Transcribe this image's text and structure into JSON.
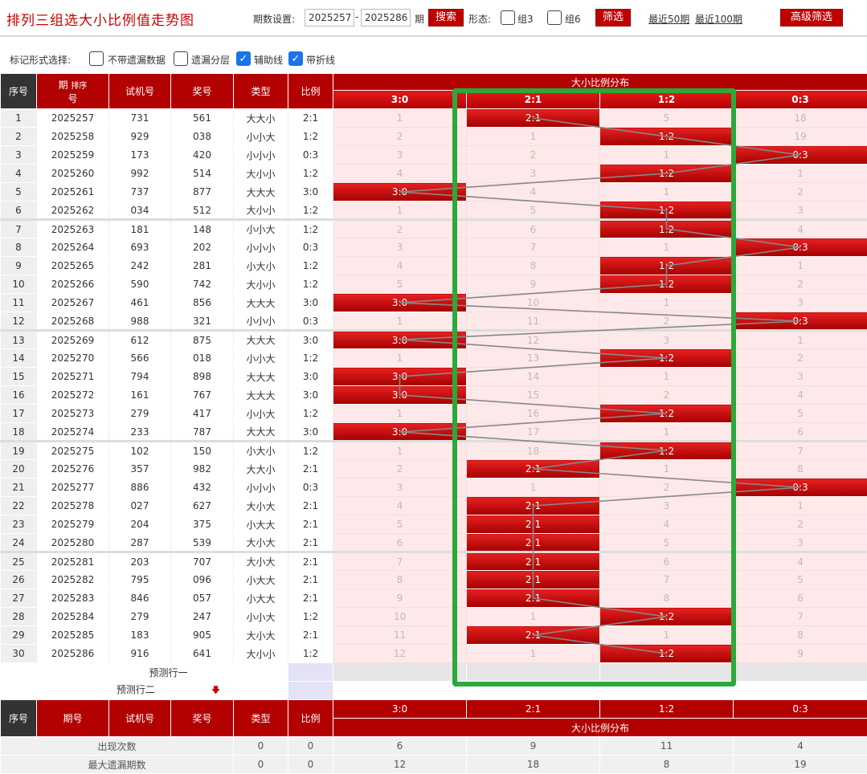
{
  "header": {
    "title": "排列三组选大小比例值走势图",
    "period_label": "期数设置:",
    "from": "2025257",
    "dash": "-",
    "to": "2025286",
    "period_suffix": "期",
    "search": "搜索",
    "shape_label": "形态:",
    "group3": "组3",
    "group6": "组6",
    "filter": "筛选",
    "recent50": "最近50期",
    "recent100": "最近100期",
    "advanced": "高级筛选"
  },
  "options": {
    "label": "标记形式选择:",
    "items": [
      {
        "text": "不带遗漏数据",
        "checked": false
      },
      {
        "text": "遗漏分层",
        "checked": false
      },
      {
        "text": "辅助线",
        "checked": true
      },
      {
        "text": "带折线",
        "checked": true
      }
    ]
  },
  "table_headers": {
    "seq": "序号",
    "period_top": "期",
    "period_bottom": "号",
    "sort": "排序",
    "trial": "试机号",
    "prize": "奖号",
    "type": "类型",
    "ratio": "比例",
    "dist": "大小比例分布",
    "cols": [
      "3:0",
      "2:1",
      "1:2",
      "0:3"
    ],
    "period": "期号"
  },
  "rows": [
    {
      "seq": "1",
      "period": "2025257",
      "trial": "731",
      "prize": "561",
      "type": "大大小",
      "ratio": "2:1",
      "cells": [
        "1",
        "2:1",
        "5",
        "18"
      ],
      "hit": 1
    },
    {
      "seq": "2",
      "period": "2025258",
      "trial": "929",
      "prize": "038",
      "type": "小小大",
      "ratio": "1:2",
      "cells": [
        "2",
        "1",
        "1:2",
        "19"
      ],
      "hit": 2
    },
    {
      "seq": "3",
      "period": "2025259",
      "trial": "173",
      "prize": "420",
      "type": "小小小",
      "ratio": "0:3",
      "cells": [
        "3",
        "2",
        "1",
        "0:3"
      ],
      "hit": 3
    },
    {
      "seq": "4",
      "period": "2025260",
      "trial": "992",
      "prize": "514",
      "type": "大小小",
      "ratio": "1:2",
      "cells": [
        "4",
        "3",
        "1:2",
        "1"
      ],
      "hit": 2
    },
    {
      "seq": "5",
      "period": "2025261",
      "trial": "737",
      "prize": "877",
      "type": "大大大",
      "ratio": "3:0",
      "cells": [
        "3:0",
        "4",
        "1",
        "2"
      ],
      "hit": 0
    },
    {
      "seq": "6",
      "period": "2025262",
      "trial": "034",
      "prize": "512",
      "type": "大小小",
      "ratio": "1:2",
      "cells": [
        "1",
        "5",
        "1:2",
        "3"
      ],
      "hit": 2
    },
    {
      "seq": "7",
      "period": "2025263",
      "trial": "181",
      "prize": "148",
      "type": "小小大",
      "ratio": "1:2",
      "cells": [
        "2",
        "6",
        "1:2",
        "4"
      ],
      "hit": 2
    },
    {
      "seq": "8",
      "period": "2025264",
      "trial": "693",
      "prize": "202",
      "type": "小小小",
      "ratio": "0:3",
      "cells": [
        "3",
        "7",
        "1",
        "0:3"
      ],
      "hit": 3
    },
    {
      "seq": "9",
      "period": "2025265",
      "trial": "242",
      "prize": "281",
      "type": "小大小",
      "ratio": "1:2",
      "cells": [
        "4",
        "8",
        "1:2",
        "1"
      ],
      "hit": 2
    },
    {
      "seq": "10",
      "period": "2025266",
      "trial": "590",
      "prize": "742",
      "type": "大小小",
      "ratio": "1:2",
      "cells": [
        "5",
        "9",
        "1:2",
        "2"
      ],
      "hit": 2
    },
    {
      "seq": "11",
      "period": "2025267",
      "trial": "461",
      "prize": "856",
      "type": "大大大",
      "ratio": "3:0",
      "cells": [
        "3:0",
        "10",
        "1",
        "3"
      ],
      "hit": 0
    },
    {
      "seq": "12",
      "period": "2025268",
      "trial": "988",
      "prize": "321",
      "type": "小小小",
      "ratio": "0:3",
      "cells": [
        "1",
        "11",
        "2",
        "0:3"
      ],
      "hit": 3
    },
    {
      "seq": "13",
      "period": "2025269",
      "trial": "612",
      "prize": "875",
      "type": "大大大",
      "ratio": "3:0",
      "cells": [
        "3:0",
        "12",
        "3",
        "1"
      ],
      "hit": 0
    },
    {
      "seq": "14",
      "period": "2025270",
      "trial": "566",
      "prize": "018",
      "type": "小小大",
      "ratio": "1:2",
      "cells": [
        "1",
        "13",
        "1:2",
        "2"
      ],
      "hit": 2
    },
    {
      "seq": "15",
      "period": "2025271",
      "trial": "794",
      "prize": "898",
      "type": "大大大",
      "ratio": "3:0",
      "cells": [
        "3:0",
        "14",
        "1",
        "3"
      ],
      "hit": 0
    },
    {
      "seq": "16",
      "period": "2025272",
      "trial": "161",
      "prize": "767",
      "type": "大大大",
      "ratio": "3:0",
      "cells": [
        "3:0",
        "15",
        "2",
        "4"
      ],
      "hit": 0
    },
    {
      "seq": "17",
      "period": "2025273",
      "trial": "279",
      "prize": "417",
      "type": "小小大",
      "ratio": "1:2",
      "cells": [
        "1",
        "16",
        "1:2",
        "5"
      ],
      "hit": 2
    },
    {
      "seq": "18",
      "period": "2025274",
      "trial": "233",
      "prize": "787",
      "type": "大大大",
      "ratio": "3:0",
      "cells": [
        "3:0",
        "17",
        "1",
        "6"
      ],
      "hit": 0
    },
    {
      "seq": "19",
      "period": "2025275",
      "trial": "102",
      "prize": "150",
      "type": "小大小",
      "ratio": "1:2",
      "cells": [
        "1",
        "18",
        "1:2",
        "7"
      ],
      "hit": 2
    },
    {
      "seq": "20",
      "period": "2025276",
      "trial": "357",
      "prize": "982",
      "type": "大大小",
      "ratio": "2:1",
      "cells": [
        "2",
        "2:1",
        "1",
        "8"
      ],
      "hit": 1
    },
    {
      "seq": "21",
      "period": "2025277",
      "trial": "886",
      "prize": "432",
      "type": "小小小",
      "ratio": "0:3",
      "cells": [
        "3",
        "1",
        "2",
        "0:3"
      ],
      "hit": 3
    },
    {
      "seq": "22",
      "period": "2025278",
      "trial": "027",
      "prize": "627",
      "type": "大小大",
      "ratio": "2:1",
      "cells": [
        "4",
        "2:1",
        "3",
        "1"
      ],
      "hit": 1
    },
    {
      "seq": "23",
      "period": "2025279",
      "trial": "204",
      "prize": "375",
      "type": "小大大",
      "ratio": "2:1",
      "cells": [
        "5",
        "2:1",
        "4",
        "2"
      ],
      "hit": 1
    },
    {
      "seq": "24",
      "period": "2025280",
      "trial": "287",
      "prize": "539",
      "type": "大小大",
      "ratio": "2:1",
      "cells": [
        "6",
        "2:1",
        "5",
        "3"
      ],
      "hit": 1
    },
    {
      "seq": "25",
      "period": "2025281",
      "trial": "203",
      "prize": "707",
      "type": "大小大",
      "ratio": "2:1",
      "cells": [
        "7",
        "2:1",
        "6",
        "4"
      ],
      "hit": 1
    },
    {
      "seq": "26",
      "period": "2025282",
      "trial": "795",
      "prize": "096",
      "type": "小大大",
      "ratio": "2:1",
      "cells": [
        "8",
        "2:1",
        "7",
        "5"
      ],
      "hit": 1
    },
    {
      "seq": "27",
      "period": "2025283",
      "trial": "846",
      "prize": "057",
      "type": "小大大",
      "ratio": "2:1",
      "cells": [
        "9",
        "2:1",
        "8",
        "6"
      ],
      "hit": 1
    },
    {
      "seq": "28",
      "period": "2025284",
      "trial": "279",
      "prize": "247",
      "type": "小小大",
      "ratio": "1:2",
      "cells": [
        "10",
        "1",
        "1:2",
        "7"
      ],
      "hit": 2
    },
    {
      "seq": "29",
      "period": "2025285",
      "trial": "183",
      "prize": "905",
      "type": "大小大",
      "ratio": "2:1",
      "cells": [
        "11",
        "2:1",
        "1",
        "8"
      ],
      "hit": 1
    },
    {
      "seq": "30",
      "period": "2025286",
      "trial": "916",
      "prize": "641",
      "type": "大小小",
      "ratio": "1:2",
      "cells": [
        "12",
        "1",
        "1:2",
        "9"
      ],
      "hit": 2
    }
  ],
  "predict": {
    "row1": "预测行一",
    "row2": "预测行二",
    "arrow": "🡇"
  },
  "stats": [
    {
      "label": "出现次数",
      "type": "0",
      "ratio": "0",
      "cells": [
        "6",
        "9",
        "11",
        "4"
      ]
    },
    {
      "label": "最大遗漏期数",
      "type": "0",
      "ratio": "0",
      "cells": [
        "12",
        "18",
        "8",
        "19"
      ]
    }
  ],
  "colors": {
    "accent": "#c00000",
    "highlight": "#2da83a",
    "miss_bg": "#fde9e9"
  }
}
